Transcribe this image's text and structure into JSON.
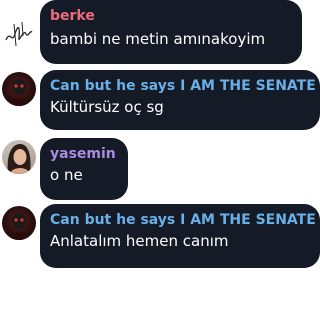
{
  "messages": [
    {
      "author": "berke",
      "author_color": "#ef6a7e",
      "text": "bambi ne metin amınakoyim",
      "avatar": "signature-avatar"
    },
    {
      "author": "Can but he says I AM THE SENATE",
      "author_color": "#6ab0e8",
      "text": "Kültürsüz oç sg",
      "avatar": "dark-character-avatar"
    },
    {
      "author": "yasemin",
      "author_color": "#a98be0",
      "text": "o ne",
      "avatar": "woman-portrait-avatar"
    },
    {
      "author": "Can but he says I AM THE SENATE",
      "author_color": "#6ab0e8",
      "text": "Anlatalım hemen canım",
      "avatar": "dark-character-avatar"
    }
  ],
  "colors": {
    "bubble_bg": "#141a26",
    "message_text": "#ffffff",
    "page_bg": "#ffffff"
  }
}
